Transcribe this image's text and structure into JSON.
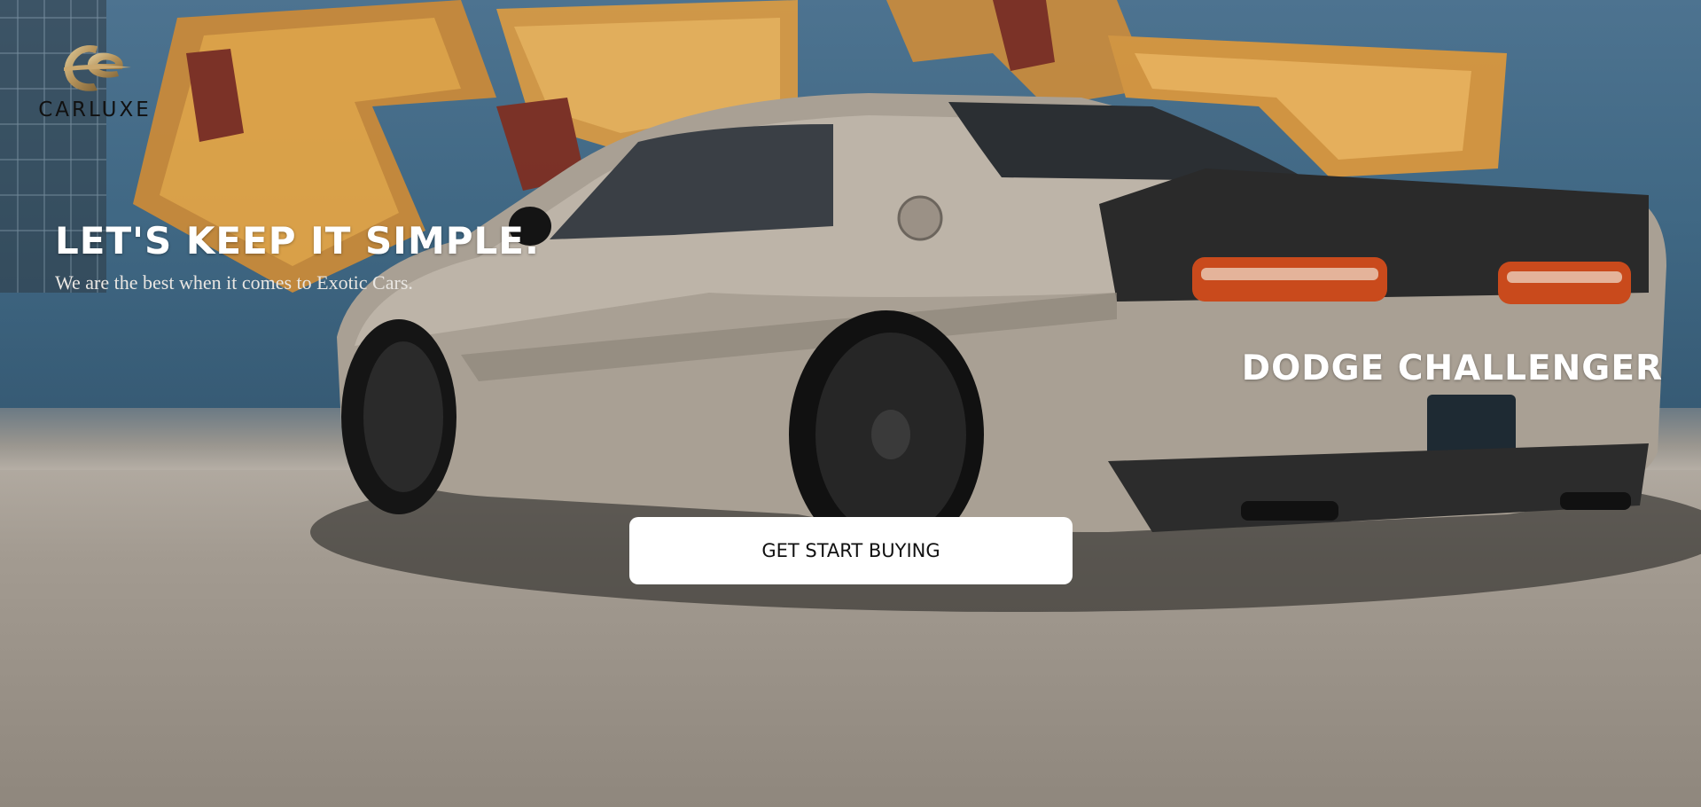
{
  "brand": {
    "logo_text": "CARLUXE",
    "logo_icon": "carluxe-monogram-icon",
    "accent": "#b99a6a"
  },
  "hero": {
    "headline": "LET'S KEEP IT SIMPLE.",
    "subheadline": "We are the best when it comes to Exotic Cars.",
    "featured_model": "DODGE CHALLENGER",
    "cta_label": "GET START BUYING",
    "background_image": "dodge-challenger-photo"
  },
  "colors": {
    "text_light": "#ffffff",
    "button_bg": "#ffffff",
    "button_text": "#111111"
  }
}
